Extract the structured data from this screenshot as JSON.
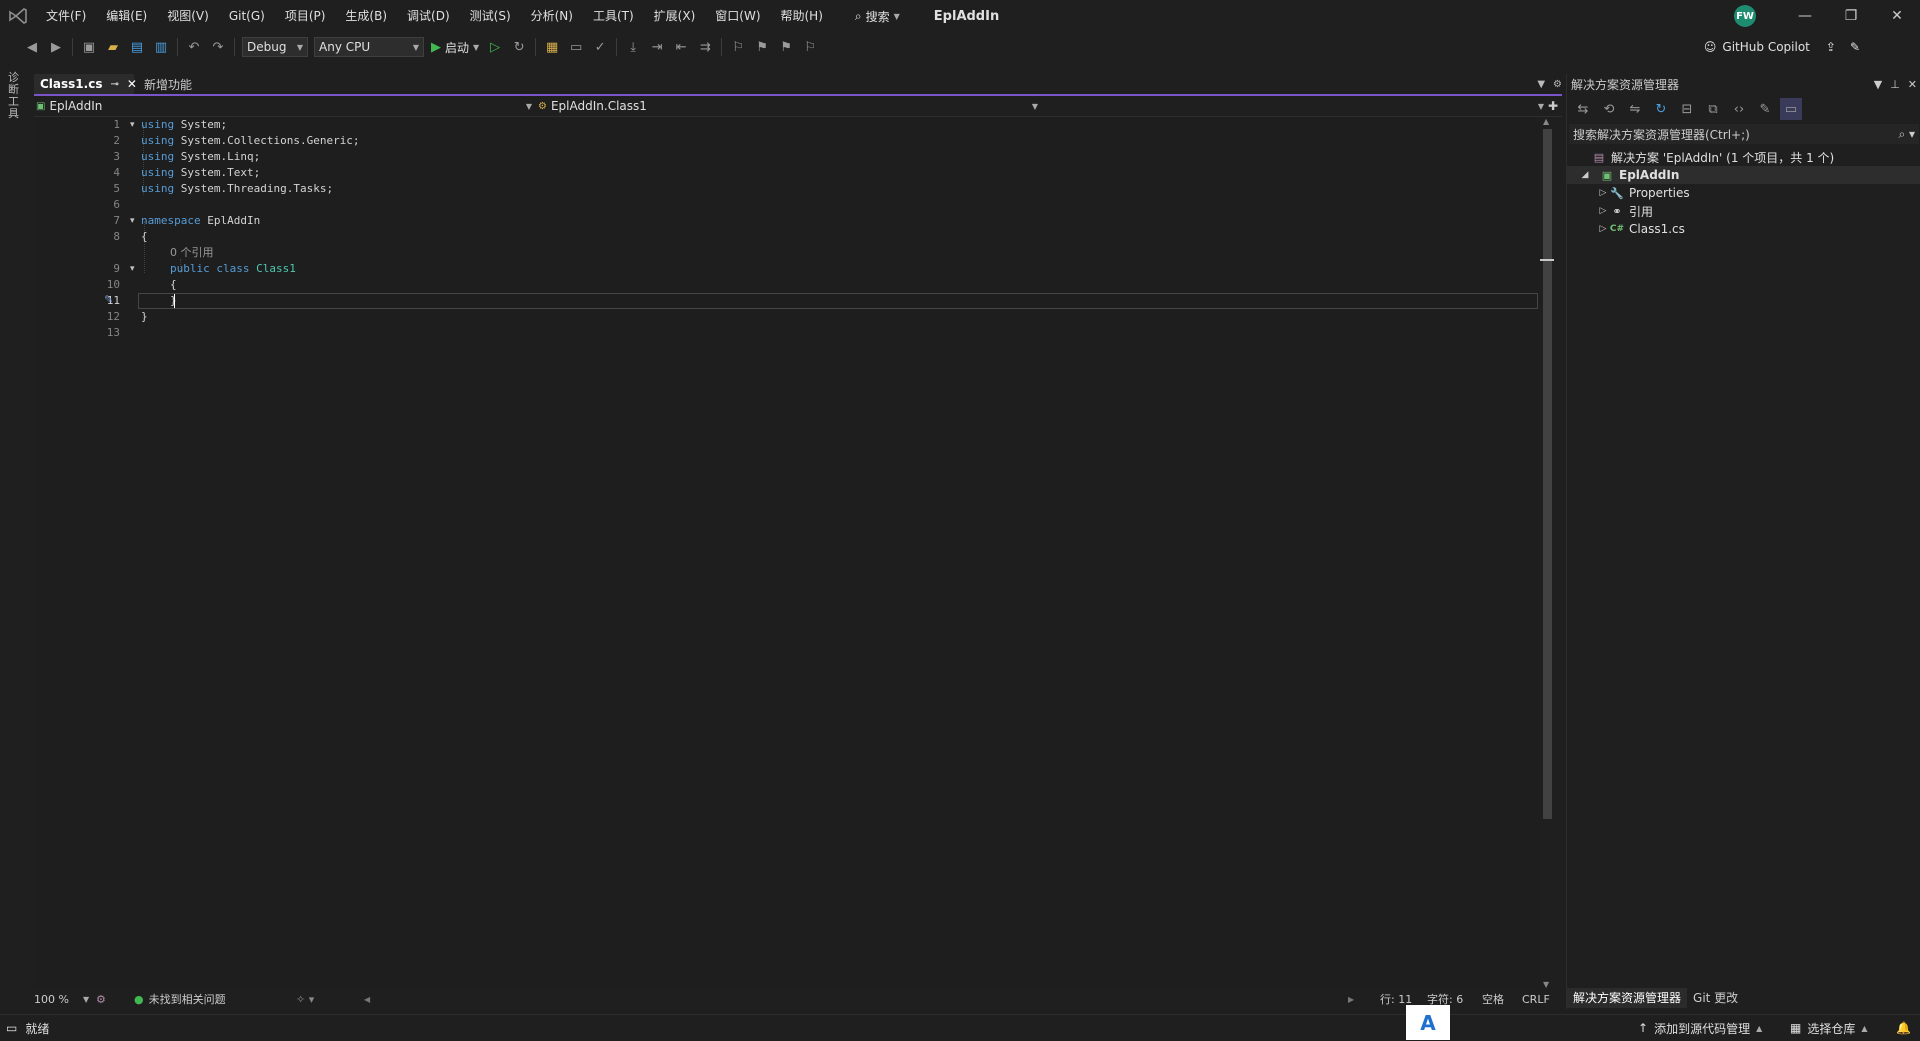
{
  "titlebar": {
    "menus": [
      "文件(F)",
      "编辑(E)",
      "视图(V)",
      "Git(G)",
      "项目(P)",
      "生成(B)",
      "调试(D)",
      "测试(S)",
      "分析(N)",
      "工具(T)",
      "扩展(X)",
      "窗口(W)",
      "帮助(H)"
    ],
    "search_label": "搜索",
    "solution_name": "EplAddIn",
    "avatar_initials": "FW"
  },
  "toolbar": {
    "configuration": "Debug",
    "platform": "Any CPU",
    "start_label": "启动",
    "copilot_label": "GitHub Copilot"
  },
  "left_strip": {
    "label": "诊断工具"
  },
  "tabs": {
    "active": "Class1.cs",
    "inactive": "新增功能"
  },
  "navbar": {
    "project": "EplAddIn",
    "type": "EplAddIn.Class1"
  },
  "code": {
    "line_numbers": [
      "1",
      "2",
      "3",
      "4",
      "5",
      "6",
      "7",
      "8",
      "9",
      "10",
      "11",
      "12",
      "13"
    ],
    "lines": {
      "l1_kw": "using",
      "l1_rest": " System;",
      "l2_kw": "using",
      "l2_rest": " System.Collections.Generic;",
      "l3_kw": "using",
      "l3_rest": " System.Linq;",
      "l4_kw": "using",
      "l4_rest": " System.Text;",
      "l5_kw": "using",
      "l5_rest": " System.Threading.Tasks;",
      "l7_kw": "namespace",
      "l7_rest": " EplAddIn",
      "l8": "{",
      "codelens": "0 个引用",
      "l9_kw": "public class",
      "l9_type": "Class1",
      "l10": "{",
      "l11": "}",
      "l12": "}"
    }
  },
  "editor_status": {
    "zoom": "100 %",
    "issues": "未找到相关问题",
    "line": "行: 11",
    "char": "字符: 6",
    "whitespace": "空格",
    "line_ending": "CRLF"
  },
  "solution_explorer": {
    "title": "解决方案资源管理器",
    "search_placeholder": "搜索解决方案资源管理器(Ctrl+;)",
    "solution_row": "解决方案 'EplAddIn' (1 个项目，共 1 个)",
    "project_row": "EplAddIn",
    "items": [
      "Properties",
      "引用",
      "Class1.cs"
    ],
    "bottom_tabs": [
      "解决方案资源管理器",
      "Git 更改"
    ]
  },
  "statusbar": {
    "ready": "就绪",
    "source_control": "添加到源代码管理",
    "repo": "选择仓库"
  },
  "ime": {
    "label": "A"
  },
  "colors": {
    "accent": "#7a54c8",
    "keyword": "#569cd6",
    "type": "#4ec9b0",
    "success": "#3fb950"
  }
}
